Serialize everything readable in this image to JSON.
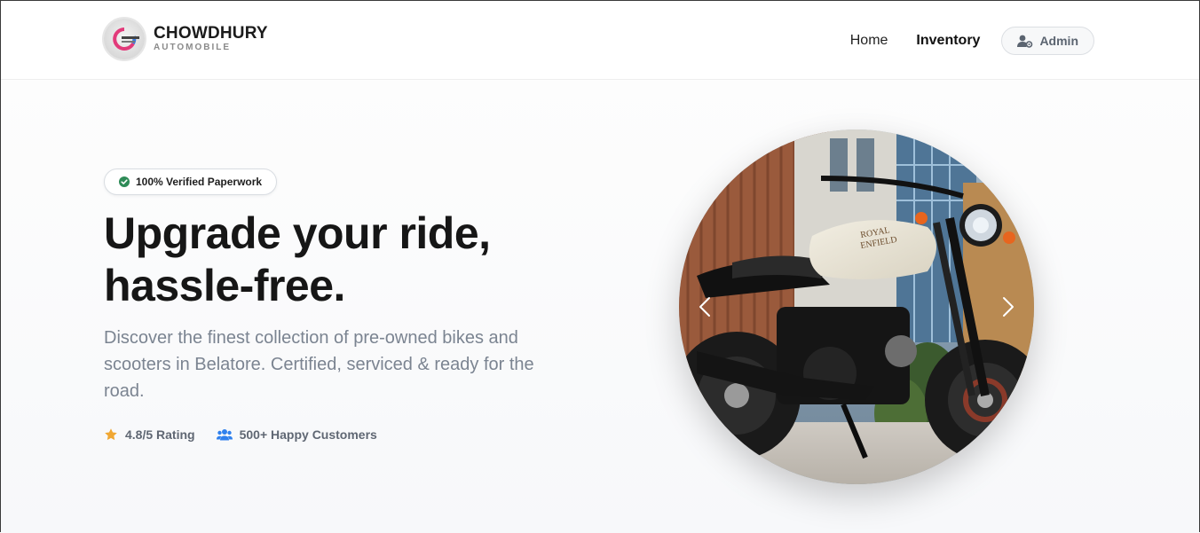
{
  "brand": {
    "name": "CHOWDHURY",
    "subtitle": "AUTOMOBILE",
    "logo_text": "CHOWDHURY AUTOMOBILE"
  },
  "nav": {
    "items": [
      {
        "label": "Home",
        "active": false
      },
      {
        "label": "Inventory",
        "active": true
      }
    ],
    "admin_label": "Admin"
  },
  "hero": {
    "badge": "100% Verified Paperwork",
    "headline_line1": "Upgrade your ride,",
    "headline_line2": "hassle-free.",
    "description": "Discover the finest collection of pre-owned bikes and scooters in Belatore. Certified, serviced & ready for the road.",
    "stats": [
      {
        "icon": "star-icon",
        "label": "4.8/5 Rating"
      },
      {
        "icon": "users-icon",
        "label": "500+ Happy Customers"
      }
    ],
    "carousel": {
      "image": "motorcycle-photo",
      "tank_brand_text": "ROYAL ENFIELD"
    }
  },
  "colors": {
    "verified_green": "#2e8b57",
    "star": "#f0a733",
    "users_blue": "#2f80ed",
    "headline": "#161616",
    "muted_text": "#7b8491"
  }
}
